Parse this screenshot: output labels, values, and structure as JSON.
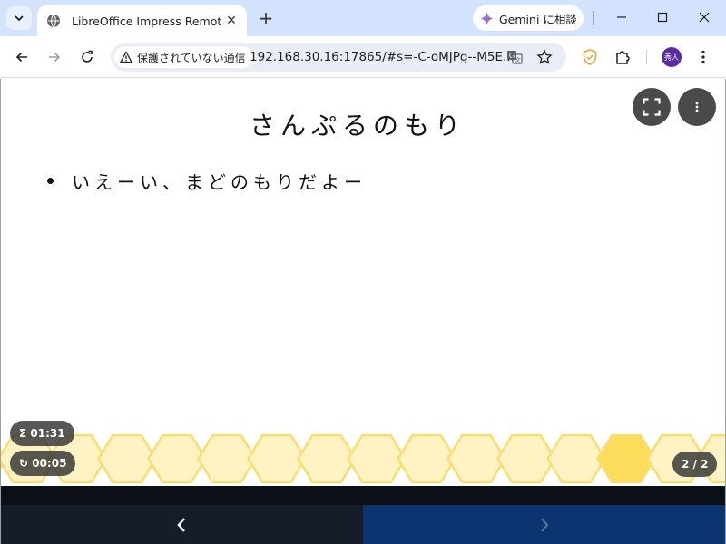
{
  "browser": {
    "tab_title": "LibreOffice Impress Remote",
    "tab_close": "✕",
    "new_tab": "+",
    "gemini_label": "Gemini に相談",
    "security_label": "保護されていない通信",
    "url": "192.168.30.16:17865/#s=-C-oMJPg--M5E...",
    "avatar_text": "秀人",
    "colors": {
      "tabstrip": "#d3e3fd",
      "omnibox": "#e9eef6",
      "avatar": "#5b2ca0"
    }
  },
  "slide": {
    "title": "さんぷるのもり",
    "bullets": [
      "いえーい、まどのもりだよー"
    ]
  },
  "remote": {
    "total_timer": "Σ 01:31",
    "slide_timer": "↻ 00:05",
    "slide_counter": "2 / 2",
    "prev_symbol": "‹",
    "next_symbol": "›",
    "colors": {
      "honeycomb_fill": "#fff3c4",
      "honeycomb_stroke": "#f9dd6e",
      "honeycomb_current": "#fddc5c",
      "prev_bg": "#151d2b",
      "next_bg": "#0b3470"
    }
  }
}
